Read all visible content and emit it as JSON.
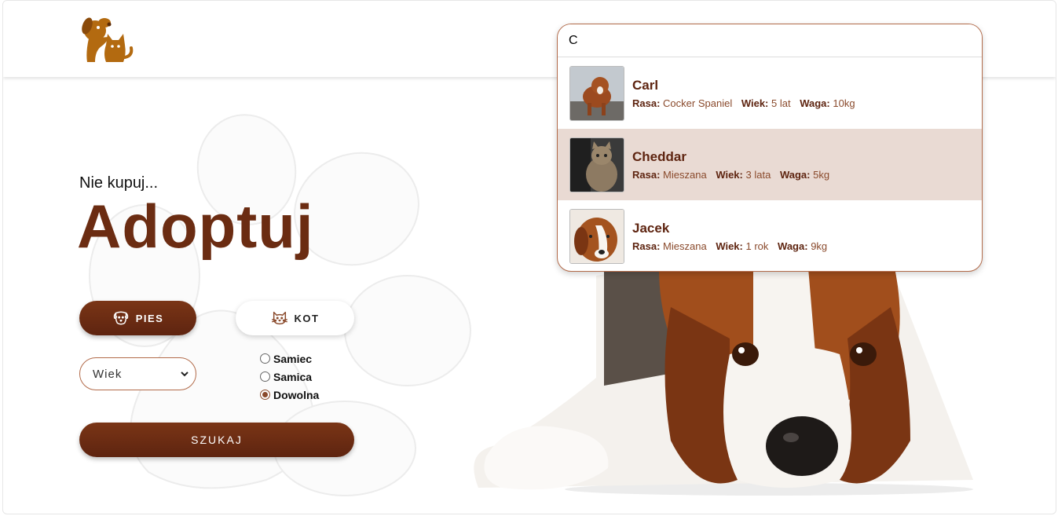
{
  "hero": {
    "tagline": "Nie kupuj...",
    "title": "Adoptuj"
  },
  "filters": {
    "dog_label": "PIES",
    "cat_label": "KOT",
    "age_select": {
      "selected": "Wiek"
    },
    "gender_options": [
      {
        "label": "Samiec",
        "checked": false
      },
      {
        "label": "Samica",
        "checked": false
      },
      {
        "label": "Dowolna",
        "checked": true
      }
    ],
    "search_label": "SZUKAJ"
  },
  "search": {
    "value": "C",
    "field_labels": {
      "breed": "Rasa:",
      "age": "Wiek:",
      "weight": "Waga:"
    },
    "results": [
      {
        "name": "Carl",
        "breed": "Cocker Spaniel",
        "age": "5 lat",
        "weight": "10kg"
      },
      {
        "name": "Cheddar",
        "breed": "Mieszana",
        "age": "3 lata",
        "weight": "5kg"
      },
      {
        "name": "Jacek",
        "breed": "Mieszana",
        "age": "1 rok",
        "weight": "9kg"
      }
    ]
  },
  "colors": {
    "brand_brown": "#6b2c12",
    "accent_brown": "#8a4a2c",
    "highlight": "#e9dad3",
    "logo": "#b36a10"
  },
  "icons": [
    "logo-dog-cat-icon",
    "dog-icon",
    "cat-icon",
    "chevron-down-icon"
  ]
}
